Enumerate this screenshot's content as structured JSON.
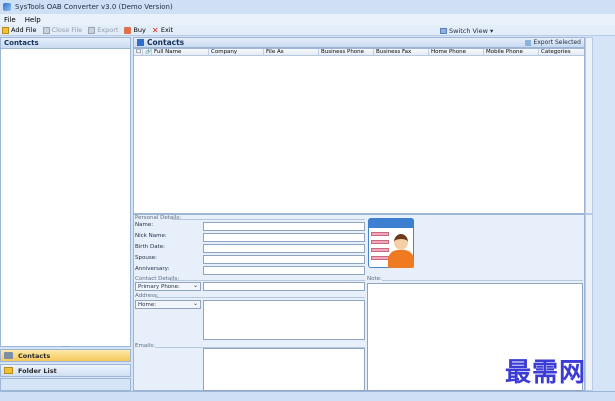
{
  "window": {
    "title": "SysTools OAB Converter v3.0 (Demo Version)"
  },
  "menu": {
    "file": "File",
    "help": "Help"
  },
  "toolbar": {
    "add_file": "Add File",
    "close_file": "Close File",
    "export": "Export",
    "buy": "Buy",
    "exit": "Exit",
    "switch_view": "Switch View"
  },
  "left_panel": {
    "header": "Contacts",
    "nav_contacts": "Contacts",
    "nav_folder_list": "Folder List"
  },
  "contacts": {
    "header": "Contacts",
    "export_selected": "Export Selected",
    "columns": [
      "Full Name",
      "Company",
      "File As",
      "Business Phone",
      "Business Fax",
      "Home Phone",
      "Mobile Phone",
      "Categories"
    ]
  },
  "details": {
    "personal_details": "Personal Details:",
    "name": "Name:",
    "nick_name": "Nick Name:",
    "birth_date": "Birth Date:",
    "spouse": "Spouse:",
    "anniversary": "Anniversary:",
    "contact_details": "Contact Details:",
    "primary_phone": "Primary Phone:",
    "address": "Address:",
    "home": "Home:",
    "emails": "Emails:",
    "note": "Note:"
  },
  "watermark": "最需网",
  "colors": {
    "accent": "#2f6fc9",
    "selected_nav": "#f6c85c",
    "panel_bg": "#d6e4f7"
  }
}
